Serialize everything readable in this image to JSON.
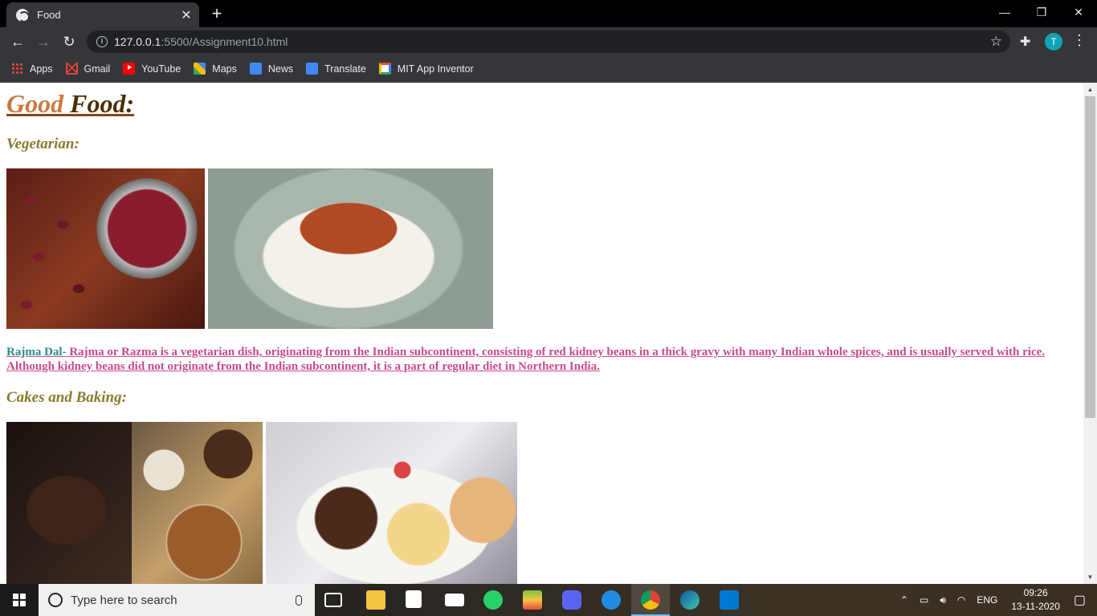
{
  "browser": {
    "tab_title": "Food",
    "new_tab": "+",
    "url_host": "127.0.0.1",
    "url_path": ":5500/Assignment10.html",
    "profile_initial": "T",
    "bookmarks": [
      {
        "label": "Apps",
        "icon": "apps-grid-icon"
      },
      {
        "label": "Gmail",
        "icon": "gmail-icon"
      },
      {
        "label": "YouTube",
        "icon": "youtube-icon"
      },
      {
        "label": "Maps",
        "icon": "maps-icon"
      },
      {
        "label": "News",
        "icon": "news-icon"
      },
      {
        "label": "Translate",
        "icon": "translate-icon"
      },
      {
        "label": "MIT App Inventor",
        "icon": "google-icon"
      }
    ]
  },
  "page": {
    "heading_good": "Good",
    "heading_food": " Food:",
    "vegetarian_title": "Vegetarian:",
    "rajma_term": "Rajma Dal-",
    "rajma_text": " Rajma or Razma is a vegetarian dish, originating from the Indian subcontinent, consisting of red kidney beans in a thick gravy with many Indian whole spices, and is usually served with rice. Although kidney beans did not originate from the Indian subcontinent, it is a part of regular diet in Northern India.",
    "cakes_title": "Cakes and Baking:"
  },
  "taskbar": {
    "search_placeholder": "Type here to search",
    "language": "ENG",
    "time": "09:26",
    "date": "13-11-2020",
    "accent": "#76b9ed"
  }
}
